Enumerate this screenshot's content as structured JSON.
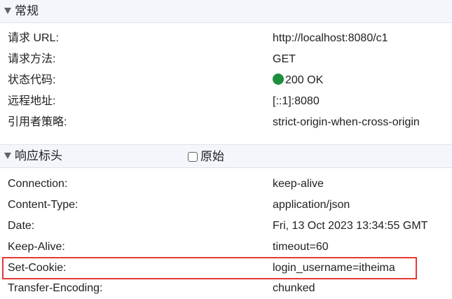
{
  "general": {
    "title": "常规",
    "rows": [
      {
        "key": "请求 URL:",
        "value": "http://localhost:8080/c1"
      },
      {
        "key": "请求方法:",
        "value": "GET"
      },
      {
        "key": "状态代码:",
        "value": "200 OK",
        "status_color": "#1e8e3e"
      },
      {
        "key": "远程地址:",
        "value": "[::1]:8080"
      },
      {
        "key": "引用者策略:",
        "value": "strict-origin-when-cross-origin"
      }
    ]
  },
  "response_headers": {
    "title": "响应标头",
    "raw_label": "原始",
    "raw_checked": false,
    "rows": [
      {
        "key": "Connection:",
        "value": "keep-alive"
      },
      {
        "key": "Content-Type:",
        "value": "application/json"
      },
      {
        "key": "Date:",
        "value": "Fri, 13 Oct 2023 13:34:55 GMT"
      },
      {
        "key": "Keep-Alive:",
        "value": "timeout=60"
      },
      {
        "key": "Set-Cookie:",
        "value": "login_username=itheima",
        "highlighted": true
      },
      {
        "key": "Transfer-Encoding:",
        "value": "chunked"
      }
    ]
  },
  "highlight_color": "#e53935",
  "icons": {
    "section_toggle": "triangle-down-icon",
    "status": "green-dot-icon",
    "raw_checkbox": "checkbox-unchecked"
  }
}
